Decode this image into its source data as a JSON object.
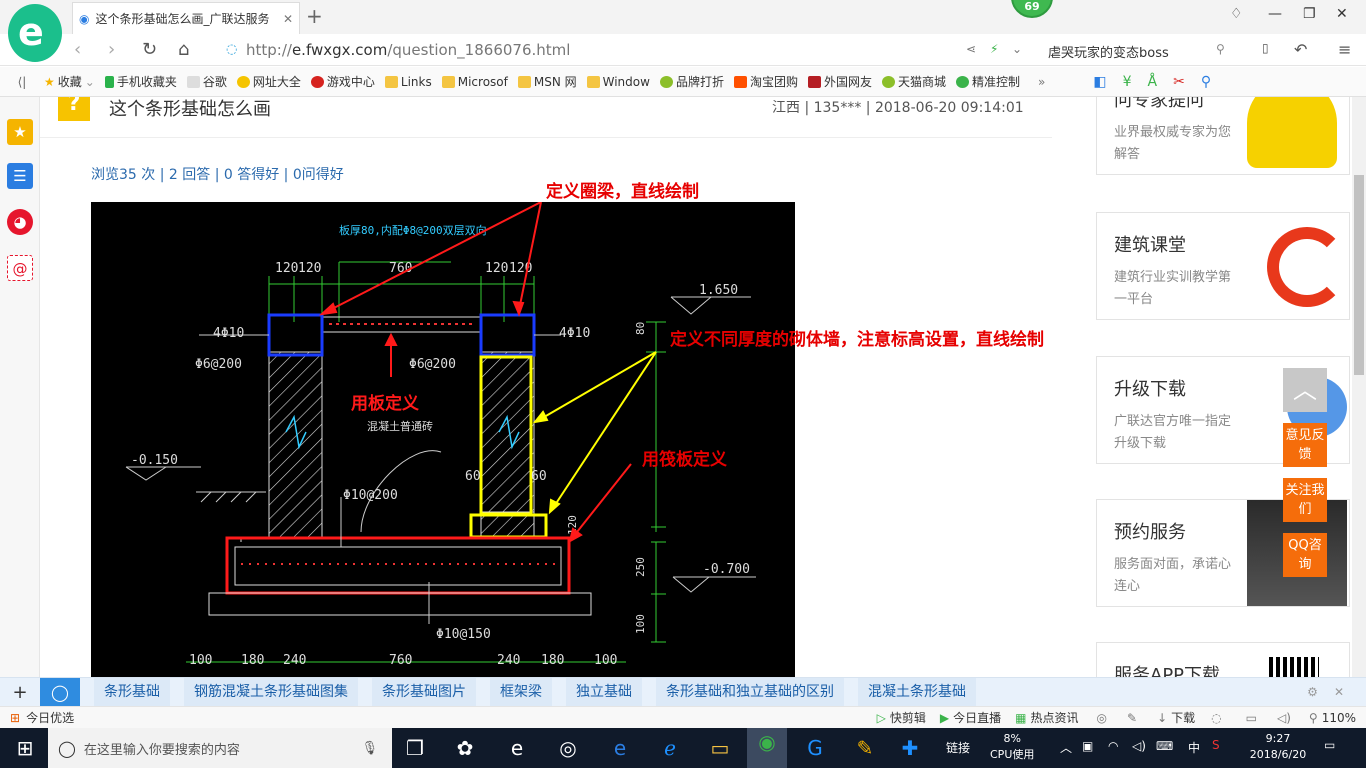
{
  "browser": {
    "tab_title": "这个条形基础怎么画_广联达服务",
    "badge": "69",
    "url_prefix": "http://",
    "url_host": "e.fwxgx.com",
    "url_path": "/question_1866076.html",
    "search_text": "虐哭玩家的变态boss"
  },
  "favorites": [
    "收藏",
    "手机收藏夹",
    "谷歌",
    "网址大全",
    "游戏中心",
    "Links",
    "Microsof",
    "MSN 网",
    "Window",
    "品牌打折",
    "淘宝团购",
    "外国网友",
    "天猫商城",
    "精准控制"
  ],
  "question": {
    "title": "这个条形基础怎么画",
    "meta": "江西 | 135*** | 2018-06-20 09:14:01",
    "stats": "浏览35 次 | 2 回答 | 0 答得好 | 0问得好"
  },
  "drawing": {
    "annotations": {
      "ring_beam": "定义圈梁，直线绘制",
      "masonry": "定义不同厚度的砌体墙，注意标高设置，直线绘制",
      "slab": "用板定义",
      "raft": "用筏板定义"
    },
    "cad_labels": {
      "slab_note": "板厚80,内配Φ8@200双层双向",
      "dim_120a": "120",
      "dim_120b": "120",
      "dim_760": "760",
      "dim_120c": "120",
      "dim_120d": "120",
      "elev_1650": "1.650",
      "rebar_4phi10_l": "4Φ10",
      "rebar_4phi10_r": "4Φ10",
      "stirrup_l": "Φ6@200",
      "stirrup_r": "Φ6@200",
      "dim_80": "80",
      "elev_m0150": "-0.150",
      "wall_note": "混凝土普通砖",
      "dim_60": "60",
      "dim_60b": "60",
      "rebar_10_200": "Φ10@200",
      "dim_120e": "120",
      "dim_250": "250",
      "elev_m0700": "-0.700",
      "rebar_10_150": "Φ10@150",
      "dim_100v": "100",
      "bottom": [
        "100",
        "180",
        "240",
        "760",
        "240",
        "180",
        "100"
      ]
    }
  },
  "sidebar_cards": [
    {
      "title": "问专家提问",
      "desc": "业界最权威专家为您解答"
    },
    {
      "title": "建筑课堂",
      "desc": "建筑行业实训教学第一平台"
    },
    {
      "title": "升级下载",
      "desc": "广联达官方唯一指定升级下载"
    },
    {
      "title": "预约服务",
      "desc": "服务面对面，承诺心连心"
    },
    {
      "title": "服务APP下载",
      "desc": ""
    }
  ],
  "floating_buttons": [
    "意见反馈",
    "关注我们",
    "QQ咨询"
  ],
  "tags": [
    "条形基础",
    "钢筋混凝土条形基础图集",
    "条形基础图片",
    "框架梁",
    "独立基础",
    "条形基础和独立基础的区别",
    "混凝土条形基础"
  ],
  "status": {
    "left": "今日优选",
    "items": [
      "快剪辑",
      "今日直播",
      "热点资讯",
      "下载"
    ],
    "zoom": "110%"
  },
  "taskbar": {
    "search_placeholder": "在这里输入你要搜索的内容",
    "link": "链接",
    "cpu_pct": "8%",
    "cpu_label": "CPU使用",
    "ime": "中",
    "time": "9:27",
    "date": "2018/6/20"
  }
}
